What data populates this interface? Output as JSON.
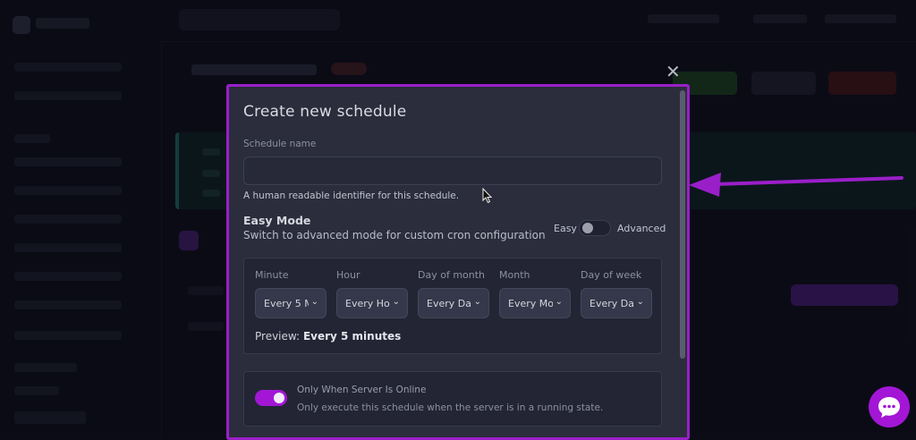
{
  "modal": {
    "title": "Create new schedule",
    "close_icon": "close-icon",
    "schedule_name": {
      "label": "Schedule name",
      "value": "",
      "placeholder": "",
      "helper": "A human readable identifier for this schedule."
    },
    "easy_mode": {
      "title": "Easy Mode",
      "description": "Switch to advanced mode for custom cron configuration",
      "left_label": "Easy",
      "right_label": "Advanced",
      "enabled": false
    },
    "cron": {
      "fields": [
        {
          "label": "Minute",
          "value": "Every 5 M"
        },
        {
          "label": "Hour",
          "value": "Every Ho"
        },
        {
          "label": "Day of month",
          "value": "Every Da"
        },
        {
          "label": "Month",
          "value": "Every Mo"
        },
        {
          "label": "Day of week",
          "value": "Every Da"
        }
      ],
      "preview_label": "Preview:",
      "preview_value": "Every 5 minutes"
    },
    "only_online": {
      "title": "Only When Server Is Online",
      "description": "Only execute this schedule when the server is in a running state.",
      "enabled": true
    }
  },
  "colors": {
    "accent": "#a316d6",
    "modal_border": "#9a1fc9",
    "annotation_arrow": "#9a1fc9"
  },
  "chat_widget": {
    "icon": "chat-icon"
  }
}
